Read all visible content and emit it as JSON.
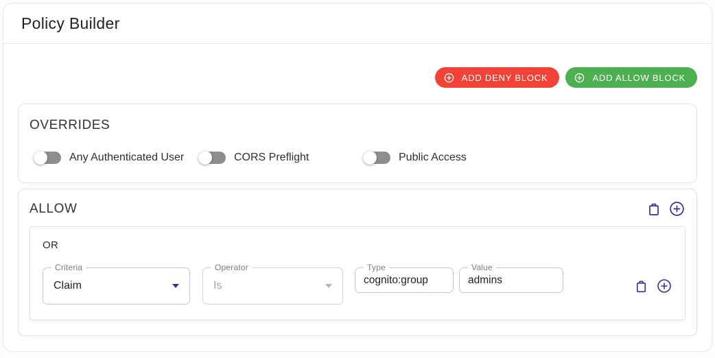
{
  "header": {
    "title": "Policy Builder"
  },
  "toolbar": {
    "add_deny_label": "ADD DENY BLOCK",
    "add_allow_label": "ADD ALLOW BLOCK"
  },
  "overrides": {
    "heading": "OVERRIDES",
    "toggles": [
      {
        "label": "Any Authenticated User",
        "state": "off"
      },
      {
        "label": "CORS Preflight",
        "state": "off"
      },
      {
        "label": "Public Access",
        "state": "off"
      }
    ]
  },
  "allow_block": {
    "heading": "ALLOW",
    "group_operator": "OR",
    "rule": {
      "criteria_label": "Criteria",
      "criteria_value": "Claim",
      "operator_label": "Operator",
      "operator_value": "Is",
      "operator_disabled": true,
      "type_label": "Type",
      "type_value": "cognito:group",
      "value_label": "Value",
      "value_value": "admins"
    }
  },
  "theme": {
    "deny_red": "#f44336",
    "allow_green": "#4caf50",
    "icon_purple": "#3a2d85",
    "toggle_track_gray": "#8e8e8e"
  }
}
